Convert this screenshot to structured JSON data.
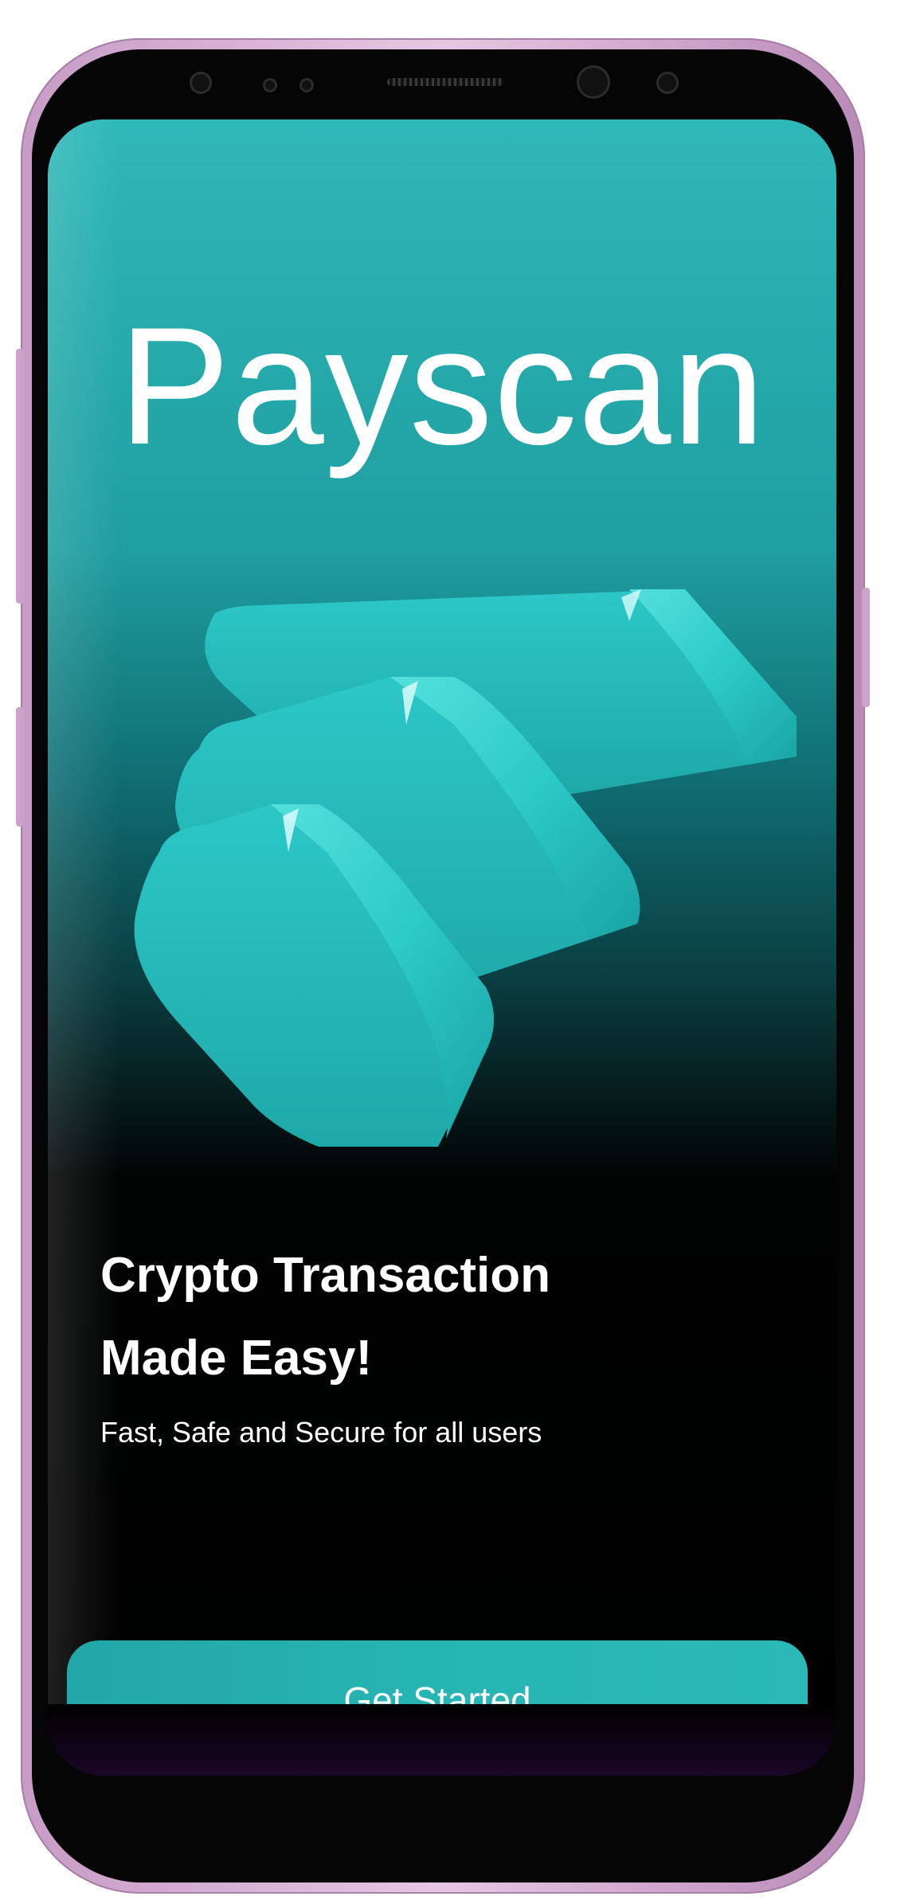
{
  "app": {
    "brand": "Payscan",
    "headline_line1": "Crypto Transaction",
    "headline_line2": "Made Easy!",
    "subtitle": "Fast, Safe and Secure for all users",
    "cta_label": "Get Started"
  },
  "colors": {
    "accent": "#27b3b2",
    "background_top": "#2fb8b8",
    "background_bottom": "#000000",
    "frame": "#d3aed2"
  },
  "icons": {
    "hero": "stacked-bars-illustration"
  }
}
